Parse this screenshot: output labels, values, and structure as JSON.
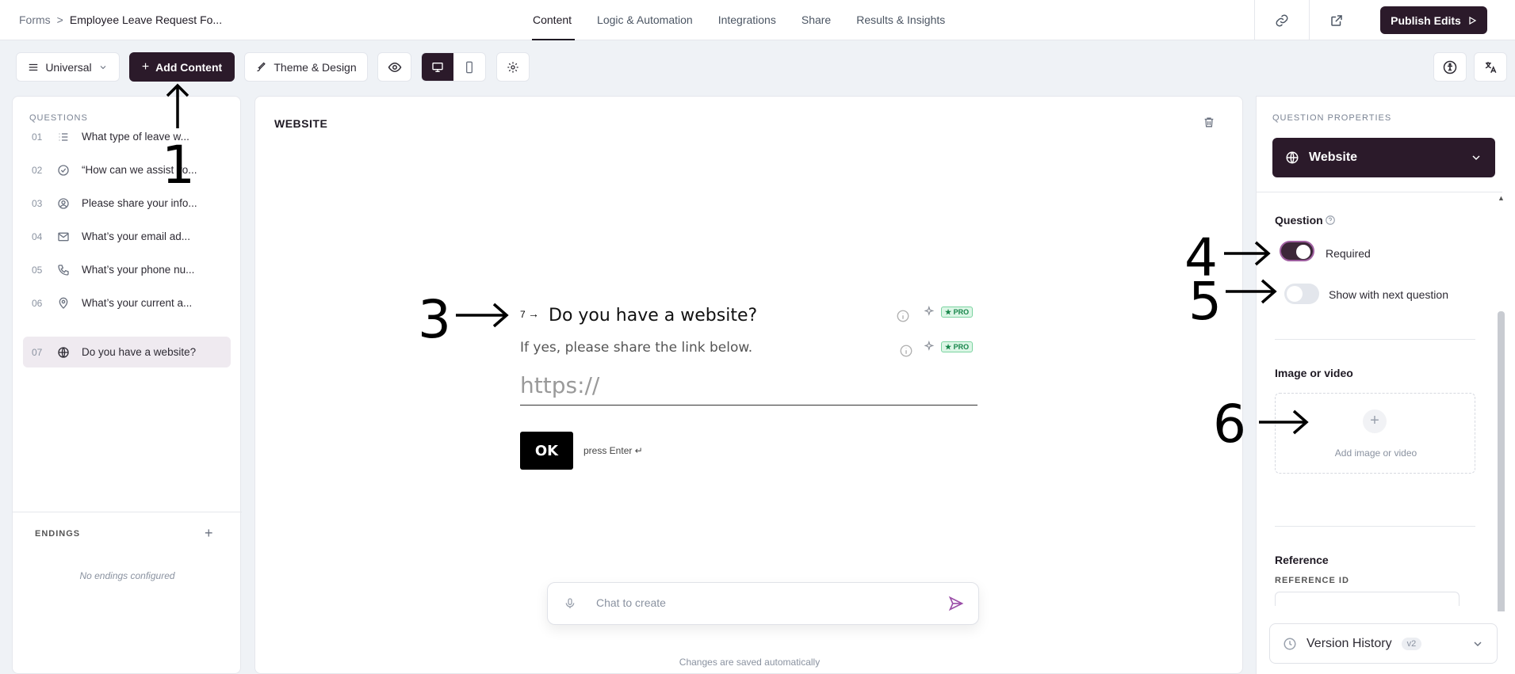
{
  "breadcrumb": {
    "root": "Forms",
    "sep": ">",
    "current": "Employee Leave Request Fo..."
  },
  "nav_tabs": [
    "Content",
    "Logic & Automation",
    "Integrations",
    "Share",
    "Results & Insights"
  ],
  "publish_label": "Publish Edits",
  "toolbar": {
    "universal": "Universal",
    "add_content": "Add Content",
    "theme": "Theme & Design"
  },
  "questions_label": "QUESTIONS",
  "questions": [
    {
      "num": "01",
      "icon": "list-icon",
      "text": "What type of leave w..."
    },
    {
      "num": "02",
      "icon": "check-circle-icon",
      "text": "“How can we assist yo..."
    },
    {
      "num": "03",
      "icon": "user-circle-icon",
      "text": "Please share your info..."
    },
    {
      "num": "04",
      "icon": "mail-icon",
      "text": "What’s your email ad..."
    },
    {
      "num": "05",
      "icon": "phone-icon",
      "text": "What’s your phone nu..."
    },
    {
      "num": "06",
      "icon": "location-pin-icon",
      "text": "What’s your current a..."
    },
    {
      "num": "07",
      "icon": "globe-icon",
      "text": "Do you have a website?"
    }
  ],
  "endings": {
    "label": "ENDINGS",
    "empty": "No endings configured"
  },
  "canvas": {
    "title": "WEBSITE",
    "question_number": "7",
    "question_title": "Do you have a website?",
    "description": "If yes, please share the link below.",
    "input_placeholder": "https://",
    "ok_label": "OK",
    "press_hint": "press Enter ↵",
    "pro_badge": "★ PRO",
    "chat_placeholder": "Chat to create",
    "saved_note": "Changes are saved automatically"
  },
  "properties": {
    "header": "QUESTION PROPERTIES",
    "type": "Website",
    "question_section": "Question",
    "required_label": "Required",
    "required": true,
    "show_next_label": "Show with next question",
    "show_next": false,
    "media_section": "Image or video",
    "media_add": "Add image or video",
    "reference_section": "Reference",
    "reference_id_label": "REFERENCE ID"
  },
  "version": {
    "label": "Version History",
    "tag": "v2"
  },
  "annotations": [
    "1",
    "3",
    "4",
    "5",
    "6"
  ],
  "colors": {
    "brand_dark": "#2b1a2a",
    "toggle_ring": "#9f5fa0",
    "pro_green": "#17854a"
  }
}
